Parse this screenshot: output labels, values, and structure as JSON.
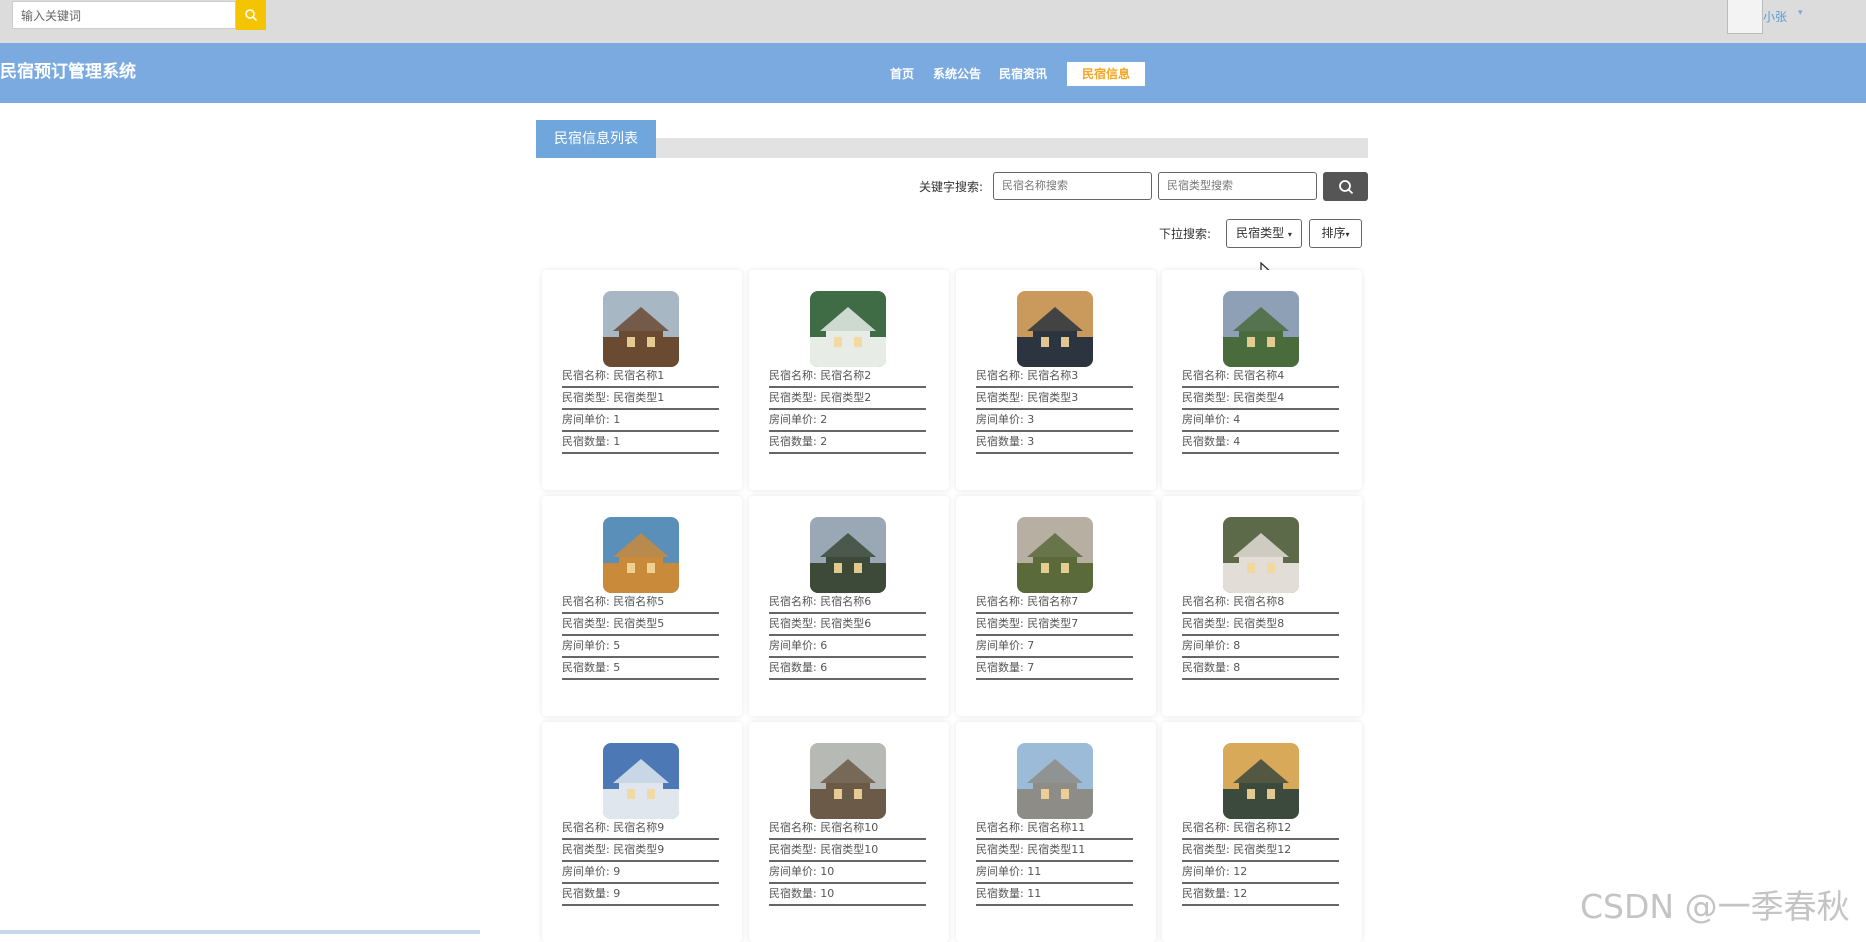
{
  "top": {
    "search_placeholder": "输入关键词",
    "username": "小张",
    "caret": "▾"
  },
  "nav": {
    "brand": "民宿预订管理系统",
    "items": [
      "首页",
      "系统公告",
      "民宿资讯",
      "民宿信息"
    ],
    "active": "民宿信息"
  },
  "list": {
    "title": "民宿信息列表",
    "keyword_label": "关键字搜索:",
    "name_placeholder": "民宿名称搜索",
    "type_placeholder": "民宿类型搜索",
    "dropdown_label": "下拉搜索:",
    "type_dropdown": "民宿类型",
    "sort_dropdown": "排序"
  },
  "cards": [
    {
      "name": "民宿名称: 民宿名称1",
      "type": "民宿类型: 民宿类型1",
      "price": "房间单价: 1",
      "count": "民宿数量: 1",
      "c1": "#6b4a32",
      "c2": "#a8b7c4"
    },
    {
      "name": "民宿名称: 民宿名称2",
      "type": "民宿类型: 民宿类型2",
      "price": "房间单价: 2",
      "count": "民宿数量: 2",
      "c1": "#e8ece7",
      "c2": "#3f6b45"
    },
    {
      "name": "民宿名称: 民宿名称3",
      "type": "民宿类型: 民宿类型3",
      "price": "房间单价: 3",
      "count": "民宿数量: 3",
      "c1": "#2c3440",
      "c2": "#c99a5c"
    },
    {
      "name": "民宿名称: 民宿名称4",
      "type": "民宿类型: 民宿类型4",
      "price": "房间单价: 4",
      "count": "民宿数量: 4",
      "c1": "#4a6b3c",
      "c2": "#8da0b5"
    },
    {
      "name": "民宿名称: 民宿名称5",
      "type": "民宿类型: 民宿类型5",
      "price": "房间单价: 5",
      "count": "民宿数量: 5",
      "c1": "#c98a3a",
      "c2": "#5a8fb9"
    },
    {
      "name": "民宿名称: 民宿名称6",
      "type": "民宿类型: 民宿类型6",
      "price": "房间单价: 6",
      "count": "民宿数量: 6",
      "c1": "#3d4a3a",
      "c2": "#9aa8b6"
    },
    {
      "name": "民宿名称: 民宿名称7",
      "type": "民宿类型: 民宿类型7",
      "price": "房间单价: 7",
      "count": "民宿数量: 7",
      "c1": "#5a6a3a",
      "c2": "#b7b0a2"
    },
    {
      "name": "民宿名称: 民宿名称8",
      "type": "民宿类型: 民宿类型8",
      "price": "房间单价: 8",
      "count": "民宿数量: 8",
      "c1": "#e2ddd6",
      "c2": "#5d6a4a"
    },
    {
      "name": "民宿名称: 民宿名称9",
      "type": "民宿类型: 民宿类型9",
      "price": "房间单价: 9",
      "count": "民宿数量: 9",
      "c1": "#dfe6ee",
      "c2": "#4c78b5"
    },
    {
      "name": "民宿名称: 民宿名称10",
      "type": "民宿类型: 民宿类型10",
      "price": "房间单价: 10",
      "count": "民宿数量: 10",
      "c1": "#6b5a48",
      "c2": "#b6b9b4"
    },
    {
      "name": "民宿名称: 民宿名称11",
      "type": "民宿类型: 民宿类型11",
      "price": "房间单价: 11",
      "count": "民宿数量: 11",
      "c1": "#8d8c86",
      "c2": "#9bbbd8"
    },
    {
      "name": "民宿名称: 民宿名称12",
      "type": "民宿类型: 民宿类型12",
      "price": "房间单价: 12",
      "count": "民宿数量: 12",
      "c1": "#3c4a3e",
      "c2": "#d9a95a"
    }
  ],
  "watermark": "CSDN @一季春秋"
}
